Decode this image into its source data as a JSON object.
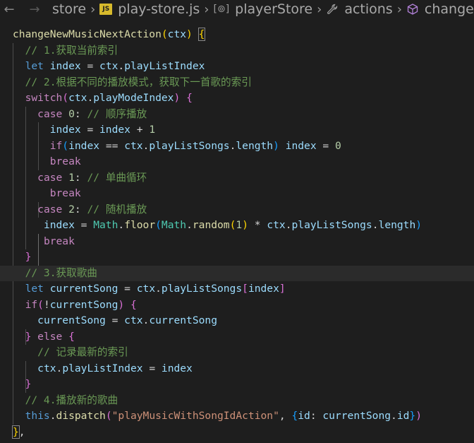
{
  "breadcrumb": {
    "segments": [
      "store",
      "play-store.js",
      "playerStore",
      "actions",
      "change"
    ],
    "js_badge": "JS"
  },
  "code": {
    "lines": [
      "changeNewMusicNextAction(ctx) {",
      "  // 1.获取当前索引",
      "  let index = ctx.playListIndex",
      "  // 2.根据不同的播放模式，获取下一首歌的索引",
      "  switch(ctx.playModeIndex) {",
      "    case 0: // 顺序播放",
      "      index = index + 1",
      "      if(index == ctx.playListSongs.length) index = 0",
      "      break",
      "    case 1: // 单曲循环",
      "      break",
      "    case 2: // 随机播放",
      "     index = Math.floor(Math.random(1) * ctx.playListSongs.length)",
      "     break",
      "  }",
      "  // 3.获取歌曲",
      "  let currentSong = ctx.playListSongs[index]",
      "  if(!currentSong) {",
      "    currentSong = ctx.currentSong",
      "  } else {",
      "    // 记录最新的索引",
      "    ctx.playListIndex = index",
      "  }",
      "  // 4.播放新的歌曲",
      "  this.dispatch(\"playMusicWithSongIdAction\", {id: currentSong.id})",
      "},"
    ],
    "highlighted_line": 16
  },
  "colors": {
    "background": "#1e1e1e",
    "function": "#dcdcaa",
    "keyword": "#569cd6",
    "control": "#c586c0",
    "variable": "#9cdcfe",
    "number": "#b5cea8",
    "string": "#ce9178",
    "comment": "#6a9955",
    "class": "#4ec9b0"
  },
  "icons": {
    "back": "arrow-left-icon",
    "forward": "arrow-right-icon",
    "symbol_class": "symbol-class-icon",
    "symbol_property": "wrench-icon",
    "symbol_method": "cube-icon"
  }
}
